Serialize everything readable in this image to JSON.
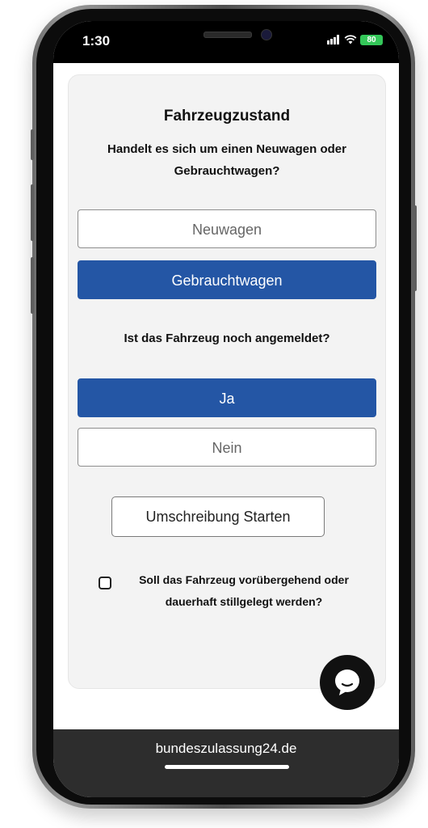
{
  "status_bar": {
    "time": "1:30",
    "battery": "80",
    "battery_color": "#34c759"
  },
  "form": {
    "title": "Fahrzeugzustand",
    "question_condition": "Handelt es sich um einen Neuwagen oder Gebrauchtwagen?",
    "option_new": "Neuwagen",
    "option_used": "Gebrauchtwagen",
    "condition_selected": "Gebrauchtwagen",
    "question_registered": "Ist das Fahrzeug noch angemeldet?",
    "option_yes": "Ja",
    "option_no": "Nein",
    "registered_selected": "Ja",
    "start_button": "Umschreibung Starten",
    "decommission_label": "Soll das Fahrzeug vorübergehend oder dauerhaft stillgelegt werden?",
    "decommission_checked": false
  },
  "colors": {
    "accent": "#2456a5",
    "card_background": "#f3f3f3"
  },
  "browser": {
    "url": "bundeszulassung24.de"
  },
  "icons": {
    "chat": "chat-bubble-icon",
    "wifi": "wifi-icon",
    "signal": "signal-icon",
    "battery": "battery-icon"
  }
}
